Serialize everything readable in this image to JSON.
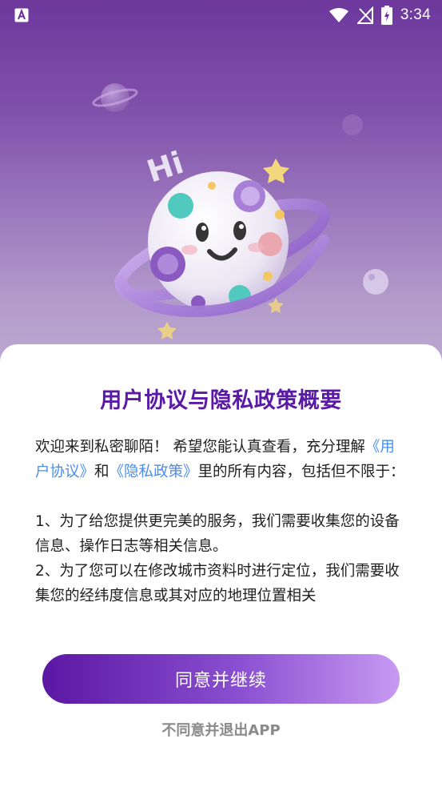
{
  "status_bar": {
    "time": "3:34",
    "notification_icon": "accessibility-a-icon",
    "wifi_icon": "wifi-icon",
    "signal_icon": "no-signal-icon",
    "battery_icon": "battery-charging-icon"
  },
  "hero": {
    "greeting": "Hi",
    "illustration": "smiling-planet-mascot"
  },
  "dialog": {
    "title": "用户协议与隐私政策概要",
    "intro_part1": "欢迎来到私密聊陌！ 希望您能认真查看，充分理解",
    "user_agreement_link": "《用户协议》",
    "and": "和",
    "privacy_policy_link": "《隐私政策》",
    "intro_part2": "里的所有内容，包括但不限于：",
    "item1": "1、为了给您提供更完美的服务，我们需要收集您的设备信息、操作日志等相关信息。",
    "item2": "2、为了您可以在修改城市资料时进行定位，我们需要收集您的经纬度信息或其对应的地理位置相关",
    "agree_button": "同意并继续",
    "disagree_link": "不同意并退出APP"
  },
  "colors": {
    "title": "#5b1aa6",
    "link": "#4a8df0",
    "button_start": "#5b17a3",
    "button_end": "#c79af2"
  }
}
